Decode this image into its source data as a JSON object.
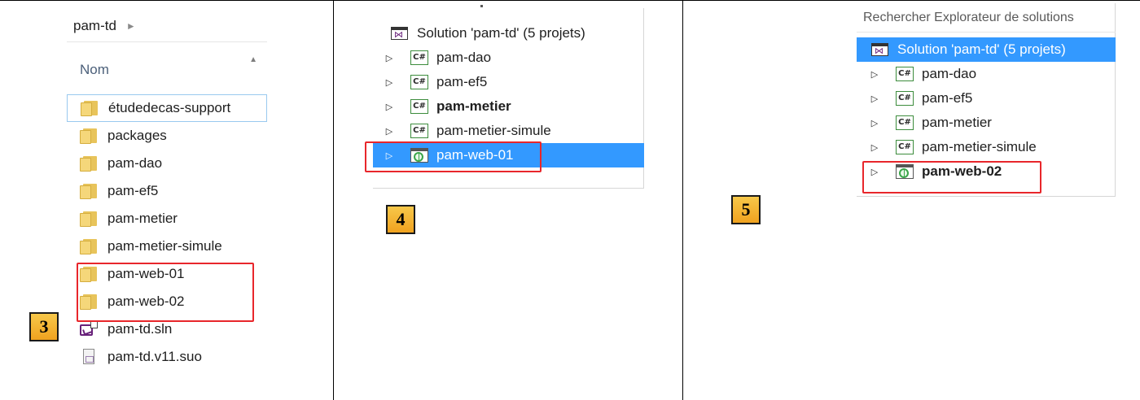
{
  "explorer": {
    "breadcrumb": "pam-td",
    "column_header": "Nom",
    "items": [
      {
        "name": "étudedecas-support",
        "type": "folder"
      },
      {
        "name": "packages",
        "type": "folder"
      },
      {
        "name": "pam-dao",
        "type": "folder"
      },
      {
        "name": "pam-ef5",
        "type": "folder"
      },
      {
        "name": "pam-metier",
        "type": "folder"
      },
      {
        "name": "pam-metier-simule",
        "type": "folder"
      },
      {
        "name": "pam-web-01",
        "type": "folder"
      },
      {
        "name": "pam-web-02",
        "type": "folder"
      },
      {
        "name": "pam-td.sln",
        "type": "solution-file"
      },
      {
        "name": "pam-td.v11.suo",
        "type": "suo-file"
      }
    ]
  },
  "solution_panel_4": {
    "solution_label": "Solution 'pam-td' (5 projets)",
    "projects": [
      {
        "name": "pam-dao",
        "icon": "csharp-project-icon"
      },
      {
        "name": "pam-ef5",
        "icon": "csharp-project-icon"
      },
      {
        "name": "pam-metier",
        "icon": "csharp-project-icon",
        "bold": true
      },
      {
        "name": "pam-metier-simule",
        "icon": "csharp-project-icon"
      },
      {
        "name": "pam-web-01",
        "icon": "web-project-icon",
        "selected": true
      }
    ]
  },
  "solution_panel_5": {
    "search_placeholder": "Rechercher Explorateur de solutions",
    "solution_label": "Solution 'pam-td' (5 projets)",
    "projects": [
      {
        "name": "pam-dao",
        "icon": "csharp-project-icon"
      },
      {
        "name": "pam-ef5",
        "icon": "csharp-project-icon"
      },
      {
        "name": "pam-metier",
        "icon": "csharp-project-icon"
      },
      {
        "name": "pam-metier-simule",
        "icon": "csharp-project-icon"
      },
      {
        "name": "pam-web-02",
        "icon": "web-project-icon",
        "bold": true
      }
    ]
  },
  "badges": {
    "b3": "3",
    "b4": "4",
    "b5": "5"
  },
  "icons": {
    "csharp": "C#",
    "expand": "▷"
  },
  "colors": {
    "selection": "#3399ff",
    "highlight_box": "#e8262b",
    "badge": "#f0a21f"
  }
}
